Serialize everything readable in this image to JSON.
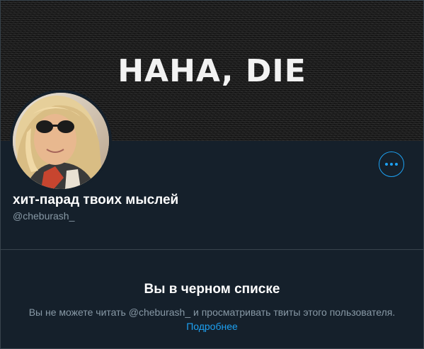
{
  "banner": {
    "text": "HAHA, DIE"
  },
  "profile": {
    "display_name": "хит-парад твоих мыслей",
    "handle": "@cheburash_",
    "more_icon": "more-horizontal-icon"
  },
  "blocked": {
    "title": "Вы в черном списке",
    "description": "Вы не можете читать @cheburash_ и просматривать твиты этого пользователя.",
    "link": "Подробнее"
  },
  "colors": {
    "background": "#15202b",
    "border": "#38444d",
    "accent": "#1da1f2",
    "secondary_text": "#8899a6",
    "primary_text": "#ffffff"
  }
}
